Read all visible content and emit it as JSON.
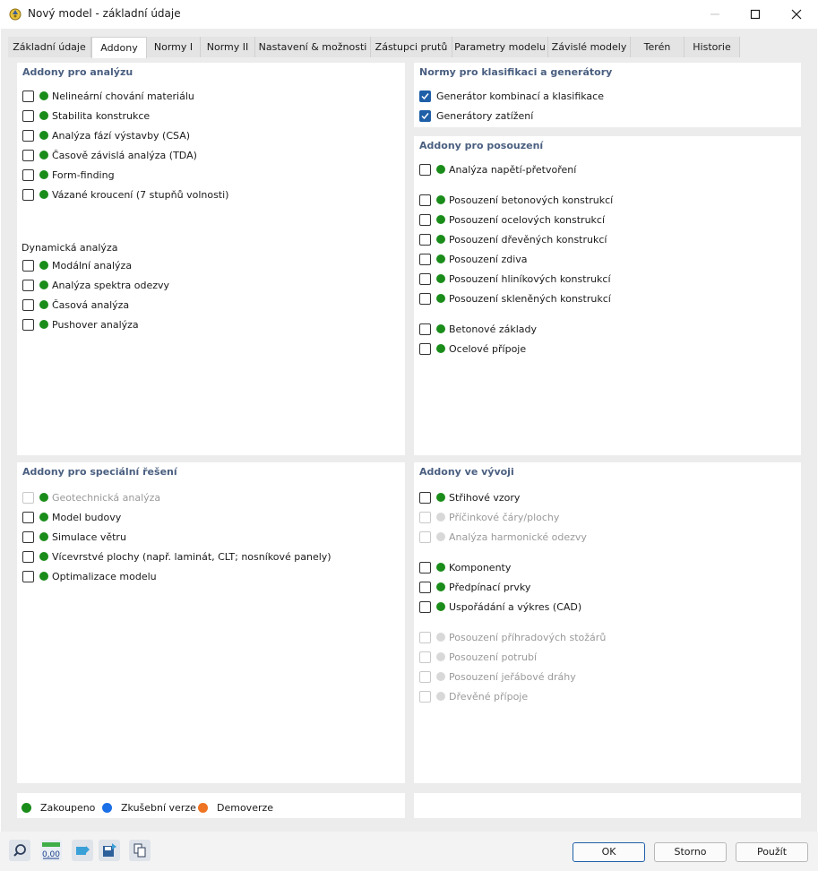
{
  "window": {
    "title": "Nový model - základní údaje"
  },
  "tabs": [
    {
      "label": "Základní údaje"
    },
    {
      "label": "Addony"
    },
    {
      "label": "Normy I"
    },
    {
      "label": "Normy II"
    },
    {
      "label": "Nastavení & možnosti"
    },
    {
      "label": "Zástupci prutů"
    },
    {
      "label": "Parametry modelu"
    },
    {
      "label": "Závislé modely"
    },
    {
      "label": "Terén"
    },
    {
      "label": "Historie"
    }
  ],
  "analysis": {
    "title": "Addony pro analýzu",
    "items": [
      {
        "label": "Nelineární chování materiálu"
      },
      {
        "label": "Stabilita konstrukce"
      },
      {
        "label": "Analýza fází výstavby (CSA)"
      },
      {
        "label": "Časově závislá analýza (TDA)"
      },
      {
        "label": "Form-finding"
      },
      {
        "label": "Vázané kroucení (7 stupňů volnosti)"
      }
    ],
    "dynamic_title": "Dynamická analýza",
    "dynamic_items": [
      {
        "label": "Modální analýza"
      },
      {
        "label": "Analýza spektra odezvy"
      },
      {
        "label": "Časová analýza"
      },
      {
        "label": "Pushover analýza"
      }
    ]
  },
  "standards": {
    "title": "Normy pro klasifikaci a generátory",
    "items": [
      {
        "label": "Generátor kombinací a klasifikace",
        "checked": true
      },
      {
        "label": "Generátory zatížení",
        "checked": true
      }
    ]
  },
  "design": {
    "title": "Addony pro posouzení",
    "items": [
      {
        "label": "Analýza napětí-přetvoření"
      },
      {
        "label": "Posouzení betonových konstrukcí"
      },
      {
        "label": "Posouzení ocelových konstrukcí"
      },
      {
        "label": "Posouzení dřevěných konstrukcí"
      },
      {
        "label": "Posouzení zdiva"
      },
      {
        "label": "Posouzení hliníkových konstrukcí"
      },
      {
        "label": "Posouzení skleněných konstrukcí"
      },
      {
        "label": "Betonové základy"
      },
      {
        "label": "Ocelové přípoje"
      }
    ]
  },
  "special": {
    "title": "Addony pro speciální řešení",
    "items": [
      {
        "label": "Geotechnická analýza",
        "disabled": true
      },
      {
        "label": "Model budovy"
      },
      {
        "label": "Simulace větru"
      },
      {
        "label": "Vícevrstvé plochy (např. laminát, CLT; nosníkové panely)"
      },
      {
        "label": "Optimalizace modelu"
      }
    ]
  },
  "development": {
    "title": "Addony ve vývoji",
    "items": [
      {
        "label": "Střihové vzory"
      },
      {
        "label": "Příčinkové čáry/plochy",
        "disabled": true
      },
      {
        "label": "Analýza harmonické odezvy",
        "disabled": true
      },
      {
        "label": "Komponenty"
      },
      {
        "label": "Předpínací prvky"
      },
      {
        "label": "Uspořádání a výkres (CAD)"
      },
      {
        "label": "Posouzení příhradových stožárů",
        "disabled": true
      },
      {
        "label": "Posouzení potrubí",
        "disabled": true
      },
      {
        "label": "Posouzení jeřábové dráhy",
        "disabled": true
      },
      {
        "label": "Dřevěné přípoje",
        "disabled": true
      }
    ]
  },
  "legend": {
    "purchased": "Zakoupeno",
    "trial": "Zkušební verze",
    "demo": "Demoverze",
    "colors": {
      "purchased": "#1a8c1a",
      "trial": "#1a6ee6",
      "demo": "#ee7322"
    }
  },
  "toolbar": {
    "value_icon_text": "0,00"
  },
  "buttons": {
    "ok": "OK",
    "cancel": "Storno",
    "apply": "Použít"
  }
}
